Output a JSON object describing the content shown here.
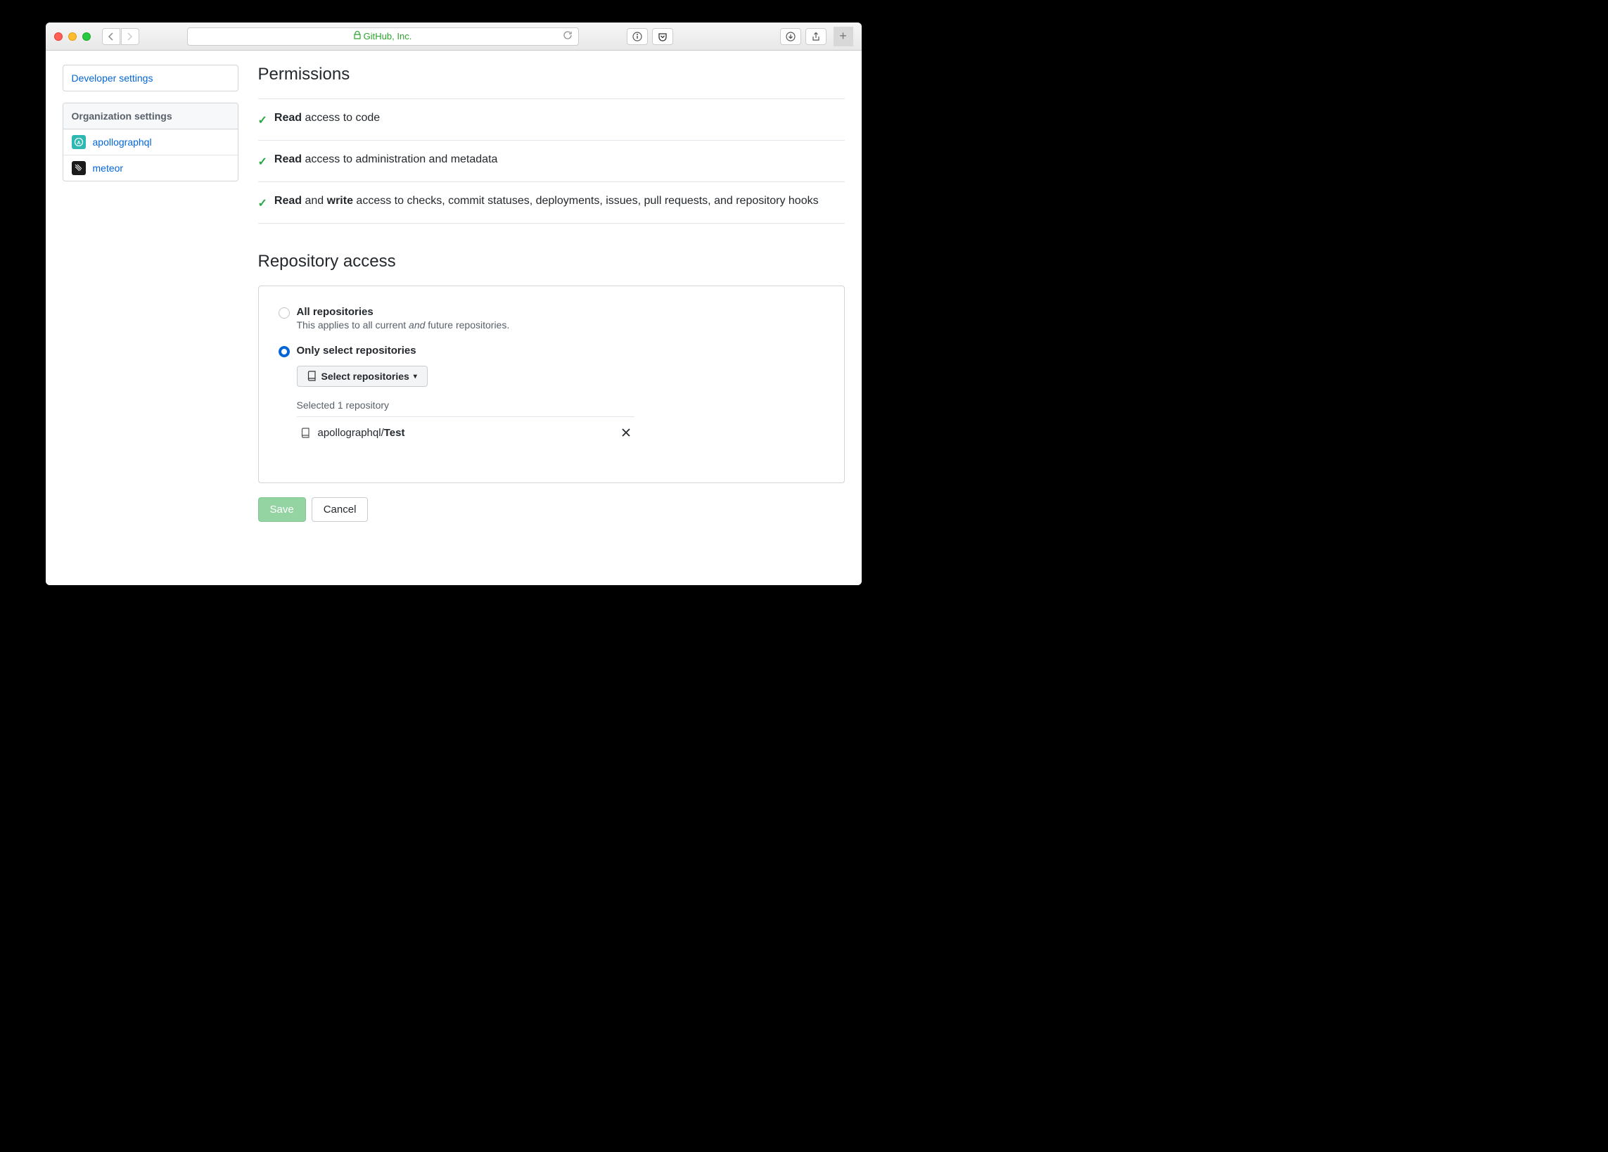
{
  "browser": {
    "address": "GitHub, Inc."
  },
  "sidebar": {
    "dev_settings": "Developer settings",
    "org_settings_header": "Organization settings",
    "orgs": [
      {
        "name": "apollographql"
      },
      {
        "name": "meteor"
      }
    ]
  },
  "permissions": {
    "heading": "Permissions",
    "items": [
      {
        "bold1": "Read",
        "rest1": " access to code"
      },
      {
        "bold1": "Read",
        "rest1": " access to administration and metadata"
      },
      {
        "bold1": "Read",
        "rest1": " and ",
        "bold2": "write",
        "rest2": " access to checks, commit statuses, deployments, issues, pull requests, and repository hooks"
      }
    ]
  },
  "repo_access": {
    "heading": "Repository access",
    "all_label": "All repositories",
    "all_desc_pre": "This applies to all current ",
    "all_desc_em": "and",
    "all_desc_post": " future repositories.",
    "select_label": "Only select repositories",
    "select_btn": "Select repositories",
    "selected_text": "Selected 1 repository",
    "selected_repos": [
      {
        "owner": "apollographql/",
        "name": "Test"
      }
    ]
  },
  "buttons": {
    "save": "Save",
    "cancel": "Cancel"
  }
}
